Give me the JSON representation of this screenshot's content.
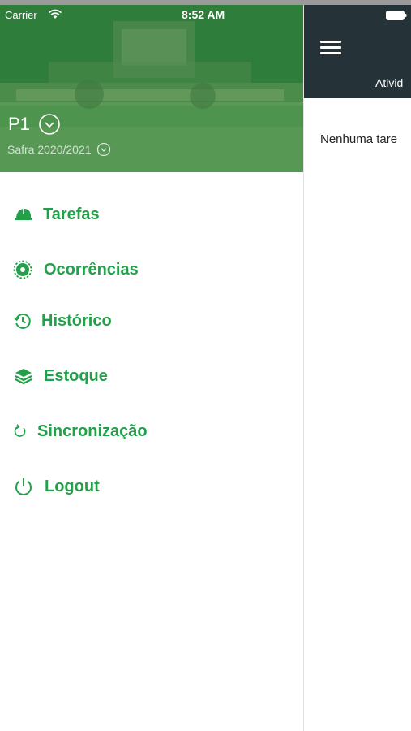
{
  "status_bar": {
    "carrier": "Carrier",
    "time": "8:52 AM"
  },
  "drawer": {
    "profile": {
      "name": "P1",
      "season": "Safra 2020/2021"
    },
    "accent_color": "#23a04a",
    "items": [
      {
        "label": "Tarefas",
        "icon": "helmet-icon"
      },
      {
        "label": "Ocorrências",
        "icon": "bug-icon"
      },
      {
        "label": "Histórico",
        "icon": "history-icon"
      },
      {
        "label": "Estoque",
        "icon": "layers-icon"
      },
      {
        "label": "Sincronização",
        "icon": "sync-icon"
      },
      {
        "label": "Logout",
        "icon": "power-icon"
      }
    ]
  },
  "main": {
    "appbar_color": "#253238",
    "tab_label": "Ativid",
    "empty_message": "Nenhuma tare"
  }
}
